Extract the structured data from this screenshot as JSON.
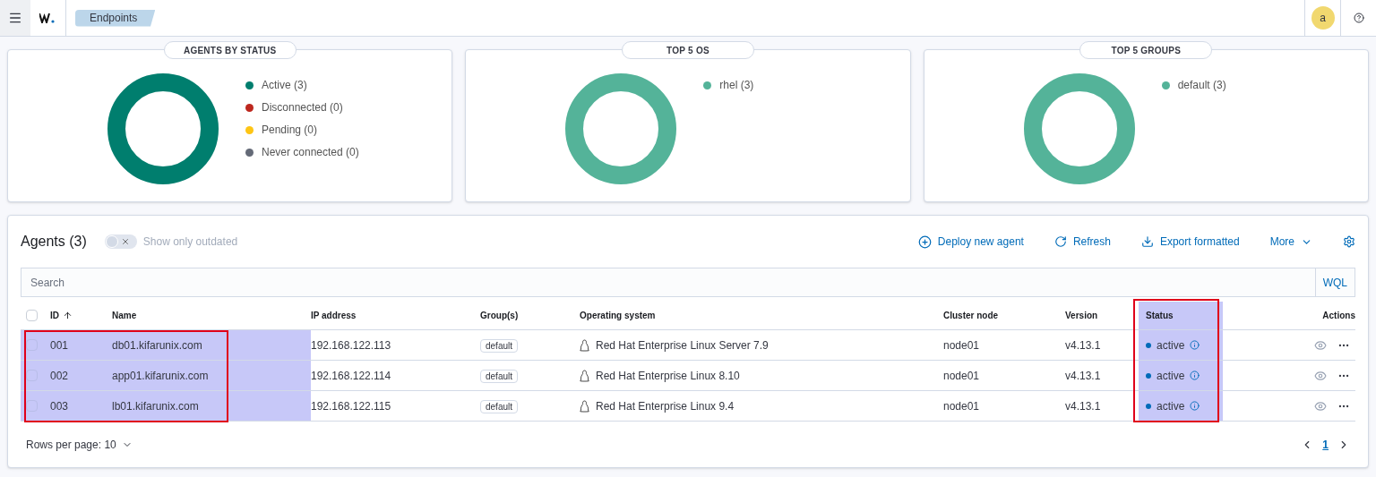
{
  "header": {
    "breadcrumb": "Endpoints",
    "avatar": "a"
  },
  "cards": [
    {
      "title": "AGENTS BY STATUS",
      "legend": [
        {
          "label": "Active (3)",
          "color": "#007e6e"
        },
        {
          "label": "Disconnected (0)",
          "color": "#bd271e"
        },
        {
          "label": "Pending (0)",
          "color": "#fec514"
        },
        {
          "label": "Never connected (0)",
          "color": "#646a77"
        }
      ]
    },
    {
      "title": "TOP 5 OS",
      "legend": [
        {
          "label": "rhel (3)",
          "color": "#54b399"
        }
      ]
    },
    {
      "title": "TOP 5 GROUPS",
      "legend": [
        {
          "label": "default (3)",
          "color": "#54b399"
        }
      ]
    }
  ],
  "agents": {
    "title": "Agents (3)",
    "outdated_toggle": {
      "label": "Show only outdated",
      "on": false
    },
    "actions": [
      {
        "kind": "deploy",
        "label": "Deploy new agent"
      },
      {
        "kind": "refresh",
        "label": "Refresh"
      },
      {
        "kind": "export",
        "label": "Export formatted"
      },
      {
        "kind": "more",
        "label": "More"
      }
    ],
    "search": {
      "placeholder": "Search",
      "language": "WQL"
    },
    "columns": [
      "ID",
      "Name",
      "IP address",
      "Group(s)",
      "Operating system",
      "Cluster node",
      "Version",
      "Status",
      "Actions"
    ],
    "annotations": {
      "id_name_box": true,
      "status_box": true
    },
    "select_all_checked": false,
    "rows": [
      {
        "id": "001",
        "name": "db01.kifarunix.com",
        "ip": "192.168.122.113",
        "group": "default",
        "os": "Red Hat Enterprise Linux Server 7.9",
        "node": "node01",
        "version": "v4.13.1",
        "status": "active",
        "checked": false
      },
      {
        "id": "002",
        "name": "app01.kifarunix.com",
        "ip": "192.168.122.114",
        "group": "default",
        "os": "Red Hat Enterprise Linux 8.10",
        "node": "node01",
        "version": "v4.13.1",
        "status": "active",
        "checked": false
      },
      {
        "id": "003",
        "name": "lb01.kifarunix.com",
        "ip": "192.168.122.115",
        "group": "default",
        "os": "Red Hat Enterprise Linux 9.4",
        "node": "node01",
        "version": "v4.13.1",
        "status": "active",
        "checked": false
      }
    ],
    "rows_per_page": "Rows per page: 10",
    "pages": [
      {
        "label": "1",
        "selected": true
      }
    ]
  }
}
